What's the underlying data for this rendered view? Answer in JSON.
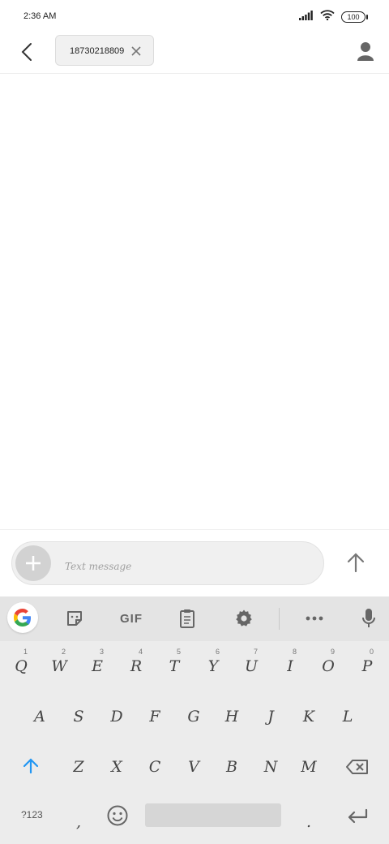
{
  "status_bar": {
    "time": "2:36 AM",
    "battery": "100"
  },
  "header": {
    "recipient": "18730218809"
  },
  "compose": {
    "placeholder": "Text message"
  },
  "keyboard": {
    "toolbar": {
      "gif_label": "GIF"
    },
    "row1": [
      {
        "key": "Q",
        "hint": "1"
      },
      {
        "key": "W",
        "hint": "2"
      },
      {
        "key": "E",
        "hint": "3"
      },
      {
        "key": "R",
        "hint": "4"
      },
      {
        "key": "T",
        "hint": "5"
      },
      {
        "key": "Y",
        "hint": "6"
      },
      {
        "key": "U",
        "hint": "7"
      },
      {
        "key": "I",
        "hint": "8"
      },
      {
        "key": "O",
        "hint": "9"
      },
      {
        "key": "P",
        "hint": "0"
      }
    ],
    "row2": [
      "A",
      "S",
      "D",
      "F",
      "G",
      "H",
      "J",
      "K",
      "L"
    ],
    "row3": [
      "Z",
      "X",
      "C",
      "V",
      "B",
      "N",
      "M"
    ],
    "symbols_label": "?123",
    "comma": ",",
    "period": "."
  }
}
